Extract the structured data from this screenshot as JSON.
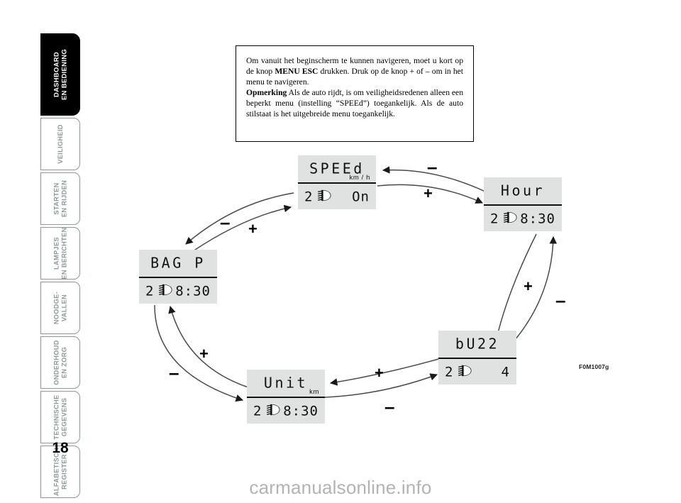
{
  "page": {
    "number": "18",
    "figure_code": "F0M1007g",
    "watermark": "carmanualsonline.info"
  },
  "sidebar": {
    "items": [
      {
        "label": "DASHBOARD\nEN BEDIENING",
        "active": true
      },
      {
        "label": "VEILIGHEID",
        "active": false
      },
      {
        "label": "STARTEN\nEN RIJDEN",
        "active": false
      },
      {
        "label": "LAMPJES\nEN BERICHTEN",
        "active": false
      },
      {
        "label": "NOODGE-\nVALLEN",
        "active": false
      },
      {
        "label": "ONDERHOUD\nEN ZORG",
        "active": false
      },
      {
        "label": "TECHNISCHE\nGEGEVENS",
        "active": false
      },
      {
        "label": "ALFABETISCH\nREGISTER",
        "active": false
      }
    ]
  },
  "note": {
    "line1_a": "Om vanuit het beginscherm te kunnen navigeren, moet u kort op de knop ",
    "line1_b": "MENU ESC",
    "line1_c": " drukken. Druk op de knop + of – om in het menu te navigeren.",
    "line2_a": "Opmerking",
    "line2_b": " Als de auto rijdt, is om veiligheidsredenen alleen een beperkt menu (instelling “SPEEd”) toegankelijk. Als de auto stilstaat is het uitgebreide menu toegankelijk."
  },
  "diagram": {
    "lcd_background": "#dfe2e0",
    "screens": [
      {
        "name": "speed",
        "title": "SPEEd",
        "unit": "km / h",
        "gear": "2",
        "value": "On",
        "icon": "low-beam-headlight-icon"
      },
      {
        "name": "hour",
        "title": "Hour",
        "unit": "",
        "gear": "2",
        "value": "8:30",
        "icon": "low-beam-headlight-icon"
      },
      {
        "name": "buzz",
        "title": "bU22",
        "unit": "",
        "gear": "2",
        "value": "4",
        "icon": "low-beam-headlight-icon"
      },
      {
        "name": "unit",
        "title": "Unit",
        "unit": "km",
        "gear": "2",
        "value": "8:30",
        "icon": "low-beam-headlight-icon"
      },
      {
        "name": "bag-p",
        "title": "BAG P",
        "unit": "",
        "gear": "2",
        "value": "8:30",
        "icon": "low-beam-headlight-icon"
      }
    ],
    "operators": [
      {
        "name": "op-speed-minus",
        "symbol": "–",
        "from": "speed",
        "to": "hour"
      },
      {
        "name": "op-speed-plus",
        "symbol": "+",
        "from": "speed",
        "to": "hour"
      },
      {
        "name": "op-hour-plus",
        "symbol": "+",
        "from": "hour",
        "to": "buzz"
      },
      {
        "name": "op-hour-minus",
        "symbol": "–",
        "from": "buzz",
        "to": "hour"
      },
      {
        "name": "op-buzz-plus",
        "symbol": "+",
        "from": "buzz",
        "to": "unit"
      },
      {
        "name": "op-buzz-minus",
        "symbol": "–",
        "from": "unit",
        "to": "buzz"
      },
      {
        "name": "op-unit-plus",
        "symbol": "+",
        "from": "unit",
        "to": "bag-p"
      },
      {
        "name": "op-unit-minus",
        "symbol": "–",
        "from": "bag-p",
        "to": "unit"
      },
      {
        "name": "op-bagp-minus",
        "symbol": "–",
        "from": "speed",
        "to": "bag-p"
      },
      {
        "name": "op-bagp-plus",
        "symbol": "+",
        "from": "bag-p",
        "to": "speed"
      }
    ]
  }
}
